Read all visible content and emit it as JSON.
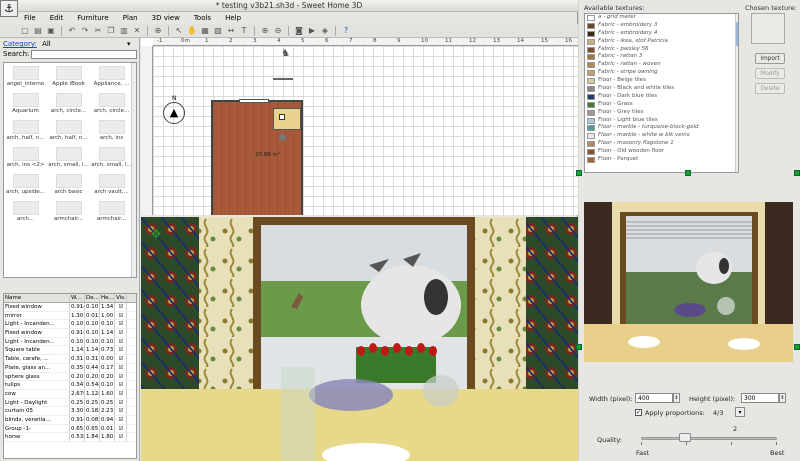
{
  "window": {
    "title": "* testing v3b21.sh3d - Sweet Home 3D"
  },
  "menu": [
    "File",
    "Edit",
    "Furniture",
    "Plan",
    "3D view",
    "Tools",
    "Help"
  ],
  "catalog": {
    "category_label": "Category:",
    "category_value": "All",
    "search_label": "Search:",
    "search_value": "",
    "items": [
      "angel_interno",
      "Apple iBook",
      "Appliance, ...",
      "Aquarium",
      "arch, circle...",
      "arch, circle...",
      "arch, half, n...",
      "arch, half, n...",
      "arch, ins",
      "arch, ins <2>",
      "arch, small, l...",
      "arch, small, l...",
      "arch, upside...",
      "arch basic",
      "arch vault,...",
      "arch...",
      "armchair...",
      "armchair..."
    ]
  },
  "furniture_table": {
    "headers": [
      "Name",
      "W...",
      "De...",
      "He...",
      "Vis..."
    ],
    "rows": [
      {
        "name": "Fixed window",
        "w": "0.914",
        "d": "0.10",
        "h": "1.34",
        "v": "☑"
      },
      {
        "name": "mirror",
        "w": "1.30",
        "d": "0.012",
        "h": "1.00",
        "v": "☑"
      },
      {
        "name": "Light - Incanden...",
        "w": "0.10",
        "d": "0.10",
        "h": "0.10",
        "v": "☑"
      },
      {
        "name": "Fixed window",
        "w": "0.914",
        "d": "0.10",
        "h": "1.14",
        "v": "☑"
      },
      {
        "name": "Light - Incanden...",
        "w": "0.10",
        "d": "0.10",
        "h": "0.10",
        "v": "☑"
      },
      {
        "name": "Square table",
        "w": "1.143",
        "d": "1.143",
        "h": "0.737",
        "v": "☑"
      },
      {
        "name": "Table, carafe, ...",
        "w": "0.311",
        "d": "0.311",
        "h": "0.00",
        "v": "☑"
      },
      {
        "name": "Plate, glass an...",
        "w": "0.35",
        "d": "0.44",
        "h": "0.173",
        "v": "☑"
      },
      {
        "name": "sphere glass",
        "w": "0.20",
        "d": "0.20",
        "h": "0.20",
        "v": "☑"
      },
      {
        "name": "tulips",
        "w": "0.347",
        "d": "0.548",
        "h": "0.10",
        "v": "☑"
      },
      {
        "name": "cow",
        "w": "2.670",
        "d": "1.128",
        "h": "1.60",
        "v": "☑"
      },
      {
        "name": "Light - Daylight",
        "w": "0.25",
        "d": "0.25",
        "h": "0.25",
        "v": "☑"
      },
      {
        "name": "curtain 05",
        "w": "3.30",
        "d": "0.182",
        "h": "2.23",
        "v": "☑"
      },
      {
        "name": "blinds, venetia...",
        "w": "0.914",
        "d": "0.082",
        "h": "0.94",
        "v": "☑"
      },
      {
        "name": "Group -1-",
        "w": "0.65",
        "d": "0.65",
        "h": "0.01",
        "v": "☑"
      },
      {
        "name": "horse",
        "w": "0.538",
        "d": "1.843",
        "h": "1.80",
        "v": "☑"
      }
    ]
  },
  "plan": {
    "ruler_labels": [
      "-1",
      "0m",
      "1",
      "2",
      "3",
      "4",
      "5",
      "6",
      "7",
      "8",
      "9",
      "10",
      "11",
      "12",
      "13",
      "14",
      "15",
      "16"
    ],
    "room_area": "23.88 m²",
    "compass_label": "N"
  },
  "texture_dialog": {
    "available_label": "Available textures:",
    "chosen_label": "Chosen texture:",
    "textures": [
      {
        "name": "a - grid meter",
        "italic": true,
        "color": "#ffffff"
      },
      {
        "name": "Fabric - embroidery 3",
        "italic": true,
        "color": "#6a4a2a"
      },
      {
        "name": "Fabric - embroidery 4",
        "italic": true,
        "color": "#3a2a1a"
      },
      {
        "name": "Fabric - ikea, stof Patricia",
        "italic": true,
        "color": "#c8b080"
      },
      {
        "name": "Fabric - paisley 56",
        "italic": true,
        "color": "#7a5030"
      },
      {
        "name": "Fabric - rattan 3",
        "italic": true,
        "color": "#a07840"
      },
      {
        "name": "Fabric - rattan - woven",
        "italic": true,
        "color": "#b08850"
      },
      {
        "name": "Fabric - stripe owning",
        "italic": true,
        "color": "#c0a070"
      },
      {
        "name": "Floor - Beige tiles",
        "italic": false,
        "color": "#d8c8a0"
      },
      {
        "name": "Floor - Black and white tiles",
        "italic": false,
        "color": "#888888"
      },
      {
        "name": "Floor - Dark blue tiles",
        "italic": false,
        "color": "#223a6a"
      },
      {
        "name": "Floor - Grass",
        "italic": false,
        "color": "#4a7a30"
      },
      {
        "name": "Floor - Grey tiles",
        "italic": false,
        "color": "#9a9a9a"
      },
      {
        "name": "Floor - Light blue tiles",
        "italic": false,
        "color": "#a8c8e0"
      },
      {
        "name": "Floor - marble - turquoise-block-gold",
        "italic": true,
        "color": "#4a9a98"
      },
      {
        "name": "Floor - marble - white w blk veins",
        "italic": true,
        "color": "#e8e8e8"
      },
      {
        "name": "Floor - masonry flagstone 1",
        "italic": true,
        "color": "#b08a60"
      },
      {
        "name": "Floor - Old wooden floor",
        "italic": false,
        "color": "#8a5030"
      },
      {
        "name": "Floor - Parquet",
        "italic": false,
        "color": "#a06a3a"
      }
    ],
    "buttons": {
      "import": "Import",
      "modify": "Modify",
      "delete": "Delete"
    },
    "width_label": "Width (pixel):",
    "width_value": "400",
    "height_label": "Height (pixel):",
    "height_value": "300",
    "apply_label": "Apply proportions:",
    "apply_value": "4/3",
    "quality_label": "Quality:",
    "quality_value": "2",
    "quality_fast": "Fast",
    "quality_best": "Best"
  }
}
